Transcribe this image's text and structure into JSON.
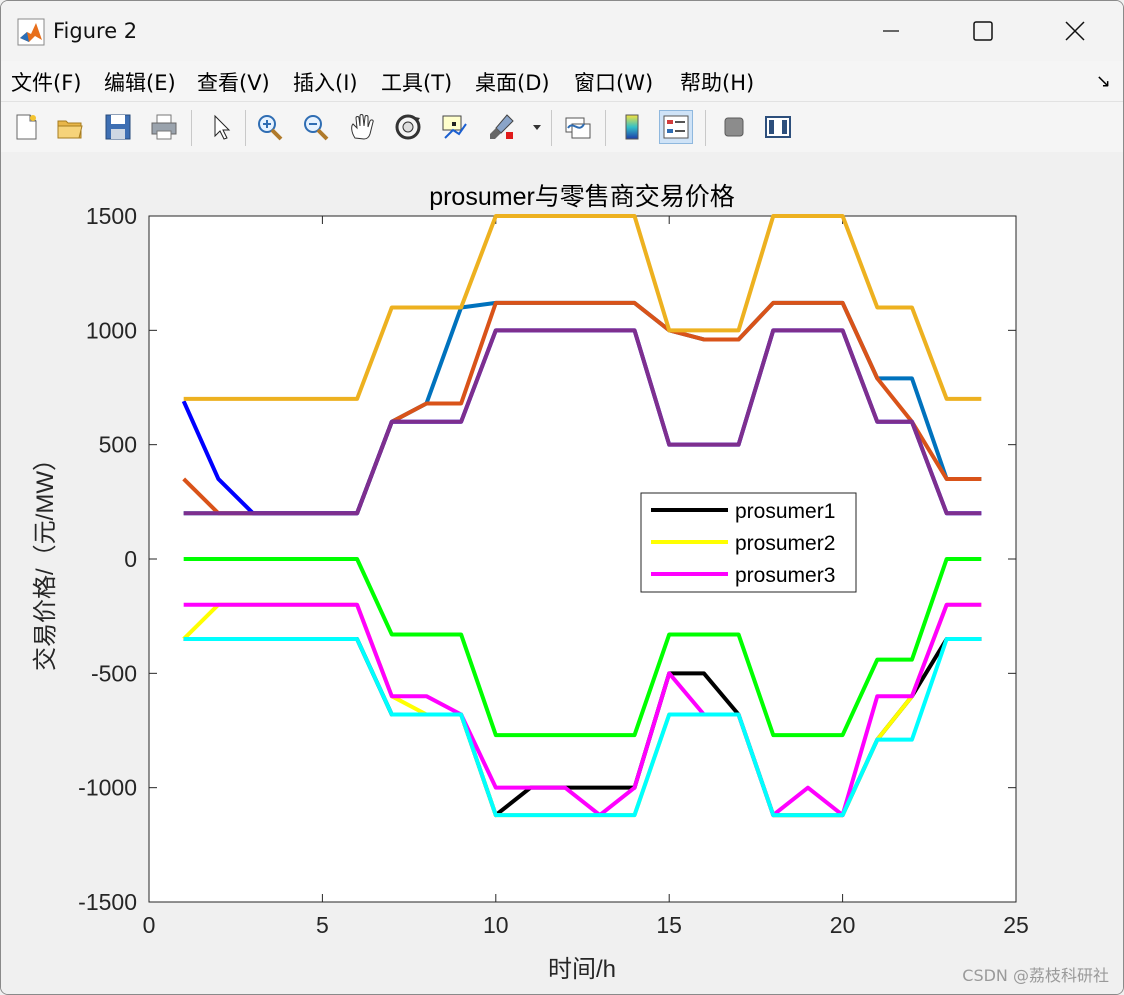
{
  "window": {
    "title": "Figure 2"
  },
  "menu": [
    {
      "label": "文件(F)"
    },
    {
      "label": "编辑(E)"
    },
    {
      "label": "查看(V)"
    },
    {
      "label": "插入(I)"
    },
    {
      "label": "工具(T)"
    },
    {
      "label": "桌面(D)"
    },
    {
      "label": "窗口(W)"
    },
    {
      "label": "帮助(H)"
    }
  ],
  "toolbar": [
    {
      "icon": "new-figure-icon"
    },
    {
      "icon": "open-file-icon"
    },
    {
      "icon": "save-icon"
    },
    {
      "icon": "print-icon"
    },
    {
      "icon": "pointer-icon"
    },
    {
      "icon": "zoom-in-icon"
    },
    {
      "icon": "zoom-out-icon"
    },
    {
      "icon": "pan-icon"
    },
    {
      "icon": "rotate-3d-icon"
    },
    {
      "icon": "data-cursor-icon"
    },
    {
      "icon": "brush-icon"
    },
    {
      "icon": "link-plot-icon"
    },
    {
      "icon": "colorbar-icon"
    },
    {
      "icon": "legend-icon",
      "active": true
    },
    {
      "icon": "hide-plot-tools-icon"
    },
    {
      "icon": "show-plot-tools-icon"
    }
  ],
  "watermark": "CSDN @荔枝科研社",
  "chart_data": {
    "type": "line",
    "title": "prosumer与零售商交易价格",
    "xlabel": "时间/h",
    "ylabel": "交易价格/（元/MW）",
    "xlim": [
      0,
      25
    ],
    "ylim": [
      -1500,
      1500
    ],
    "xticks": [
      0,
      5,
      10,
      15,
      20,
      25
    ],
    "yticks": [
      -1500,
      -1000,
      -500,
      0,
      500,
      1000,
      1500
    ],
    "x": [
      1,
      2,
      3,
      4,
      5,
      6,
      7,
      8,
      9,
      10,
      11,
      12,
      13,
      14,
      15,
      16,
      17,
      18,
      19,
      20,
      21,
      22,
      23,
      24
    ],
    "grid": false,
    "legend_position": "center-right",
    "series": [
      {
        "color": "#0072bd",
        "legend": false,
        "values": [
          200,
          200,
          200,
          200,
          200,
          200,
          600,
          680,
          1100,
          1120,
          1120,
          1120,
          1120,
          1120,
          1000,
          960,
          960,
          1120,
          1120,
          1120,
          790,
          790,
          350,
          350
        ]
      },
      {
        "color": "#d95319",
        "legend": false,
        "values": [
          350,
          200,
          200,
          200,
          200,
          200,
          600,
          680,
          680,
          1120,
          1120,
          1120,
          1120,
          1120,
          1000,
          960,
          960,
          1120,
          1120,
          1120,
          790,
          600,
          350,
          350
        ]
      },
      {
        "color": "#0000ff",
        "legend": false,
        "values": [
          690,
          350,
          200,
          200,
          200,
          200,
          600,
          600,
          600,
          1000,
          1000,
          1000,
          1000,
          1000,
          500,
          500,
          500,
          1000,
          1000,
          1000,
          600,
          600,
          200,
          200
        ]
      },
      {
        "color": "#edb120",
        "legend": false,
        "values": [
          700,
          700,
          700,
          700,
          700,
          700,
          1100,
          1100,
          1100,
          1500,
          1500,
          1500,
          1500,
          1500,
          1000,
          1000,
          1000,
          1500,
          1500,
          1500,
          1100,
          1100,
          700,
          700
        ]
      },
      {
        "color": "#7e2f8e",
        "legend": false,
        "values": [
          200,
          200,
          200,
          200,
          200,
          200,
          600,
          600,
          600,
          1000,
          1000,
          1000,
          1000,
          1000,
          500,
          500,
          500,
          1000,
          1000,
          1000,
          600,
          600,
          200,
          200
        ]
      },
      {
        "color": "#000000",
        "name": "prosumer1",
        "legend": true,
        "values": [
          -350,
          -350,
          -350,
          -350,
          -350,
          -350,
          -680,
          -680,
          -680,
          -1120,
          -1000,
          -1000,
          -1000,
          -1000,
          -500,
          -500,
          -680,
          -1120,
          -1120,
          -1120,
          -790,
          -600,
          -350,
          -350
        ]
      },
      {
        "color": "#ffff00",
        "name": "prosumer2",
        "legend": true,
        "values": [
          -350,
          -200,
          -200,
          -200,
          -200,
          -200,
          -600,
          -680,
          -680,
          -1120,
          -1120,
          -1120,
          -1120,
          -1120,
          -680,
          -680,
          -680,
          -1120,
          -1120,
          -1120,
          -790,
          -600,
          -200,
          -200
        ]
      },
      {
        "color": "#ff00ff",
        "name": "prosumer3",
        "legend": true,
        "values": [
          -200,
          -200,
          -200,
          -200,
          -200,
          -200,
          -600,
          -600,
          -680,
          -1000,
          -1000,
          -1000,
          -1120,
          -1000,
          -500,
          -680,
          -680,
          -1120,
          -1000,
          -1120,
          -600,
          -600,
          -200,
          -200
        ]
      },
      {
        "color": "#00ff00",
        "legend": false,
        "values": [
          0,
          0,
          0,
          0,
          0,
          0,
          -330,
          -330,
          -330,
          -770,
          -770,
          -770,
          -770,
          -770,
          -330,
          -330,
          -330,
          -770,
          -770,
          -770,
          -440,
          -440,
          0,
          0
        ]
      },
      {
        "color": "#00ffff",
        "legend": false,
        "values": [
          -350,
          -350,
          -350,
          -350,
          -350,
          -350,
          -680,
          -680,
          -680,
          -1120,
          -1120,
          -1120,
          -1120,
          -1120,
          -680,
          -680,
          -680,
          -1120,
          -1120,
          -1120,
          -790,
          -790,
          -350,
          -350
        ]
      }
    ]
  }
}
